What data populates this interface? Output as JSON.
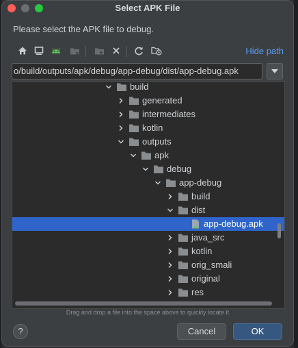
{
  "window": {
    "title": "Select APK File",
    "prompt": "Please select the APK file to debug."
  },
  "toolbar": {
    "icons": [
      "home-icon",
      "desktop-icon",
      "android-icon",
      "project-folder-icon",
      "new-folder-icon",
      "delete-icon",
      "refresh-icon",
      "show-hidden-icon"
    ],
    "hide_path_label": "Hide path"
  },
  "path": {
    "value": "o/build/outputs/apk/debug/app-debug/dist/app-debug.apk"
  },
  "tree": {
    "rows": [
      {
        "label": "build",
        "level": 0,
        "expanded": true,
        "type": "folder"
      },
      {
        "label": "generated",
        "level": 1,
        "expanded": false,
        "type": "folder"
      },
      {
        "label": "intermediates",
        "level": 1,
        "expanded": false,
        "type": "folder"
      },
      {
        "label": "kotlin",
        "level": 1,
        "expanded": false,
        "type": "folder"
      },
      {
        "label": "outputs",
        "level": 1,
        "expanded": true,
        "type": "folder"
      },
      {
        "label": "apk",
        "level": 2,
        "expanded": true,
        "type": "folder"
      },
      {
        "label": "debug",
        "level": 3,
        "expanded": true,
        "type": "folder"
      },
      {
        "label": "app-debug",
        "level": 4,
        "expanded": true,
        "type": "folder"
      },
      {
        "label": "build",
        "level": 5,
        "expanded": false,
        "type": "folder"
      },
      {
        "label": "dist",
        "level": 5,
        "expanded": true,
        "type": "folder"
      },
      {
        "label": "app-debug.apk",
        "level": 6,
        "expanded": false,
        "type": "apk",
        "selected": true
      },
      {
        "label": "java_src",
        "level": 5,
        "expanded": false,
        "type": "folder"
      },
      {
        "label": "kotlin",
        "level": 5,
        "expanded": false,
        "type": "folder"
      },
      {
        "label": "orig_smali",
        "level": 5,
        "expanded": false,
        "type": "folder"
      },
      {
        "label": "original",
        "level": 5,
        "expanded": false,
        "type": "folder"
      },
      {
        "label": "res",
        "level": 5,
        "expanded": false,
        "type": "folder"
      }
    ]
  },
  "footer": {
    "hint": "Drag and drop a file into the space above to quickly locate it",
    "help_label": "?",
    "cancel_label": "Cancel",
    "ok_label": "OK"
  },
  "colors": {
    "selection": "#2f65ca",
    "link": "#589df6",
    "ok_button": "#365880",
    "folder": "#8a8d90"
  }
}
